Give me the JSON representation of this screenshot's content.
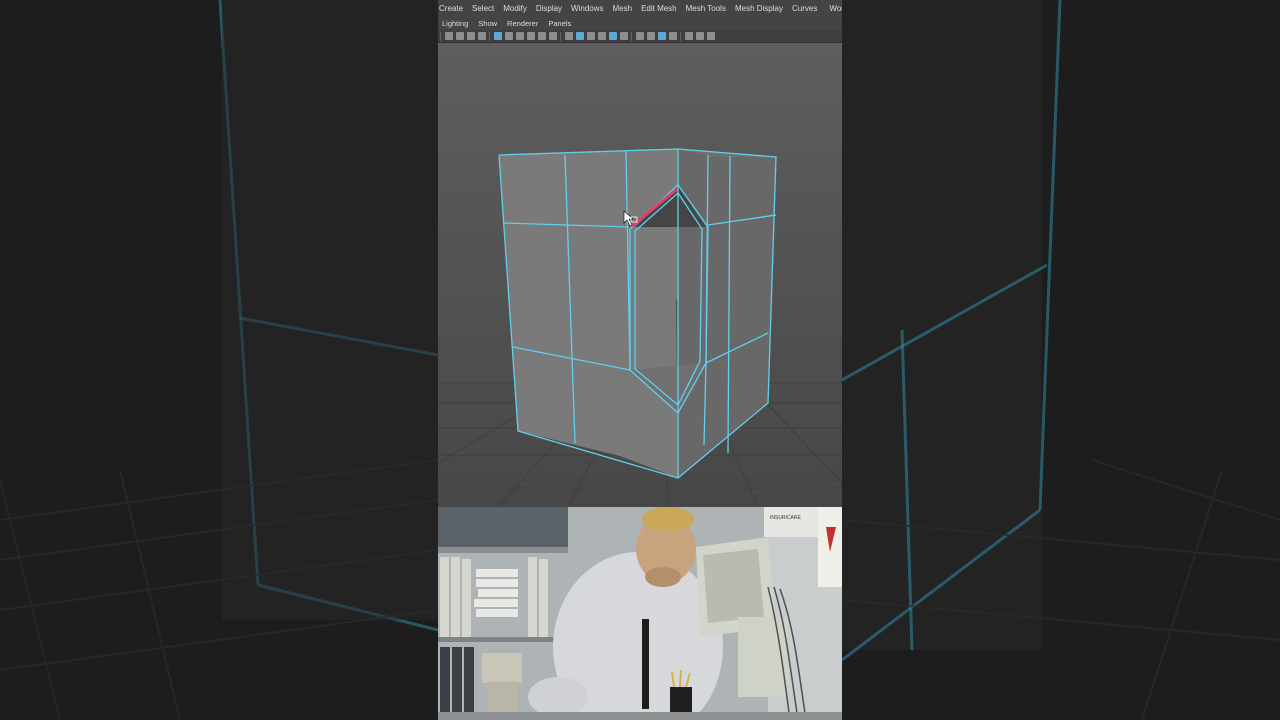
{
  "menubar": {
    "items": [
      "Create",
      "Select",
      "Modify",
      "Display",
      "Windows",
      "Mesh",
      "Edit Mesh",
      "Mesh Tools",
      "Mesh Display",
      "Curves",
      "Workspa"
    ]
  },
  "panelbar": {
    "items": [
      "Lighting",
      "Show",
      "Renderer",
      "Panels"
    ]
  },
  "toolbar": {
    "icons": [
      "camera-icon",
      "camera-attrs-icon",
      "bookmark-icon",
      "image-plane-icon",
      "grid-icon",
      "film-gate-icon",
      "resolution-gate-icon",
      "gate-mask-icon",
      "field-chart-icon",
      "safe-action-icon",
      "wireframe-icon",
      "smooth-shade-icon",
      "textured-icon",
      "lights-icon",
      "shadows-icon",
      "xray-icon",
      "isolate-icon",
      "hud-icon",
      "panel-layout-icon"
    ]
  },
  "video": {
    "poster_text": "INSURICARE"
  },
  "colors": {
    "wireframe": "#5fd0ee",
    "selected_edge": "#e0406c",
    "menu_bg": "#444444",
    "viewport_bg": "#5c5c5c"
  }
}
